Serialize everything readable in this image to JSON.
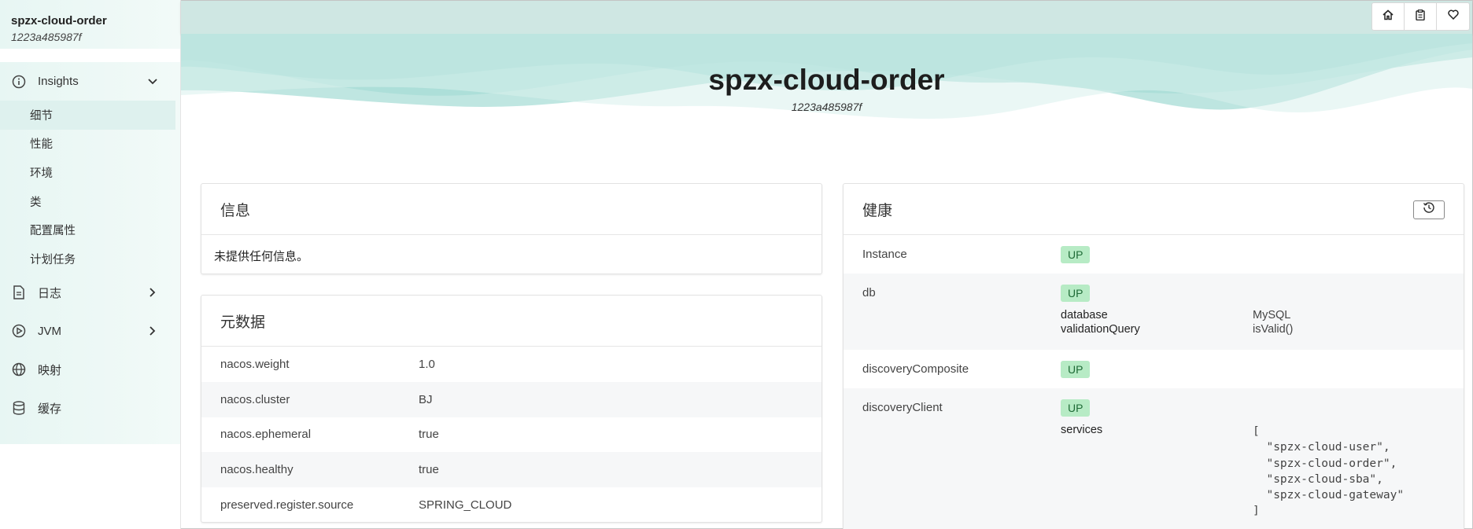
{
  "app": {
    "name": "spzx-cloud-order",
    "instance_id": "1223a485987f"
  },
  "sidebar": {
    "insights": {
      "label": "Insights"
    },
    "sub_items": [
      "细节",
      "性能",
      "环境",
      "类",
      "配置属性",
      "计划任务"
    ],
    "logs": {
      "label": "日志"
    },
    "jvm": {
      "label": "JVM"
    },
    "mappings": {
      "label": "映射"
    },
    "caches": {
      "label": "缓存"
    }
  },
  "topbar": {
    "buttons": [
      "home-icon",
      "clipboard-icon",
      "heart-icon"
    ]
  },
  "hero": {
    "title": "spzx-cloud-order",
    "subtitle": "1223a485987f"
  },
  "info": {
    "title": "信息",
    "empty_text": "未提供任何信息。"
  },
  "metadata": {
    "title": "元数据",
    "rows": [
      {
        "key": "nacos.weight",
        "value": "1.0"
      },
      {
        "key": "nacos.cluster",
        "value": "BJ"
      },
      {
        "key": "nacos.ephemeral",
        "value": "true"
      },
      {
        "key": "nacos.healthy",
        "value": "true"
      },
      {
        "key": "preserved.register.source",
        "value": "SPRING_CLOUD"
      }
    ]
  },
  "health": {
    "title": "健康",
    "components": [
      {
        "name": "Instance",
        "status": "UP"
      },
      {
        "name": "db",
        "status": "UP",
        "details": [
          {
            "key": "database",
            "value": "MySQL"
          },
          {
            "key": "validationQuery",
            "value": "isValid()"
          }
        ]
      },
      {
        "name": "discoveryComposite",
        "status": "UP"
      },
      {
        "name": "discoveryClient",
        "status": "UP",
        "details": [
          {
            "key": "services",
            "value": "[\n  \"spzx-cloud-user\",\n  \"spzx-cloud-order\",\n  \"spzx-cloud-sba\",\n  \"spzx-cloud-gateway\"\n]"
          }
        ]
      }
    ]
  },
  "colors": {
    "accent": "#42b983",
    "badge_bg": "#b7ebc5",
    "wave": "#8fd3cb"
  }
}
